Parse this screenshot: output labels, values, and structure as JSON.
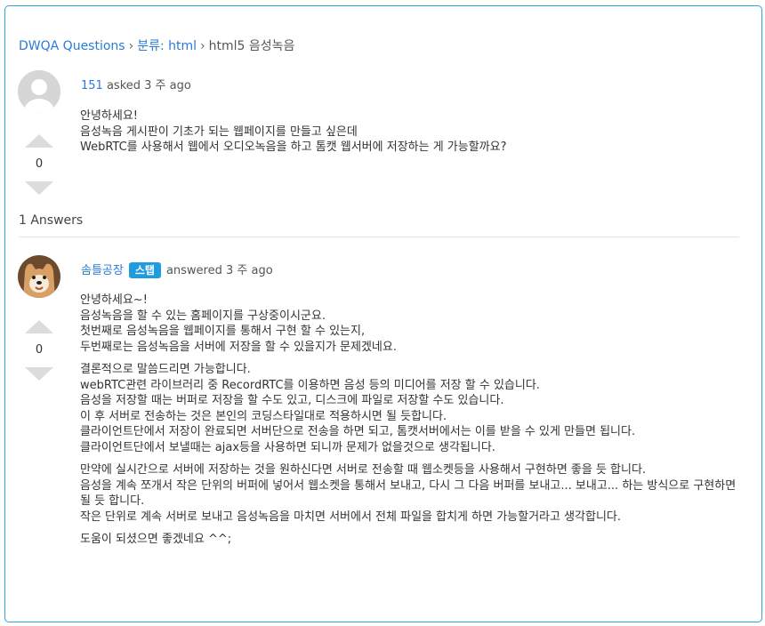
{
  "breadcrumb": {
    "root": "DWQA Questions",
    "category": "분류: html",
    "current": "html5 음성녹음",
    "separator": "›"
  },
  "question": {
    "author": "151",
    "asked": "asked 3 주 ago",
    "votes": "0",
    "lines": [
      "안녕하세요!",
      "음성녹음 게시판이 기초가 되는 웹페이지를 만들고 싶은데",
      "WebRTC를 사용해서 웹에서 오디오녹음을 하고 톰캣 웹서버에 저장하는 게 가능할까요?"
    ]
  },
  "answers_count": "1 Answers",
  "answer": {
    "author": "솜틀공장",
    "badge": "스탭",
    "answered": "answered 3 주 ago",
    "votes": "0",
    "paragraphs": [
      [
        "안녕하세요~!",
        "음성녹음을 할 수 있는 홈페이지를 구상중이시군요.",
        "첫번째로 음성녹음을 웹페이지를 통해서 구현 할 수 있는지,",
        "두번째로는 음성녹음을 서버에 저장을 할 수 있을지가 문제겠네요."
      ],
      [
        "결론적으로 말씀드리면 가능합니다.",
        "webRTC관련 라이브러리 중 RecordRTC를 이용하면 음성 등의 미디어를 저장 할 수 있습니다.",
        "음성을 저장할 때는 버퍼로 저장을 할 수도 있고, 디스크에 파일로 저장할 수도 있습니다.",
        "이 후 서버로 전송하는 것은 본인의 코딩스타일대로 적용하시면 될 듯합니다.",
        "클라이언트단에서 저장이 완료되면 서버단으로 전송을 하면 되고, 톰캣서버에서는 이를 받을 수 있게 만들면 됩니다.",
        "클라이언트단에서 보낼때는 ajax등을 사용하면 되니까 문제가 없을것으로 생각됩니다."
      ],
      [
        "만약에 실시간으로 서버에 저장하는 것을 원하신다면 서버로 전송할 때 웹소켓등을 사용해서 구현하면 좋을 듯 합니다.",
        "음성을 계속 쪼개서 작은 단위의 버퍼에 넣어서 웹소켓을 통해서 보내고, 다시 그 다음 버퍼를 보내고... 보내고... 하는 방식으로 구현하면 될 듯 합니다.",
        "작은 단위로 계속 서버로 보내고 음성녹음을 마치면 서버에서 전체 파일을 합치게 하면 가능할거라고 생각합니다."
      ],
      [
        "도움이 되셨으면 좋겠네요 ^^;"
      ]
    ]
  },
  "colors": {
    "link": "#2b7bd6",
    "badge": "#1f9ce0",
    "border": "#2ea3d4",
    "vote_arrow": "#dcdcdc"
  }
}
